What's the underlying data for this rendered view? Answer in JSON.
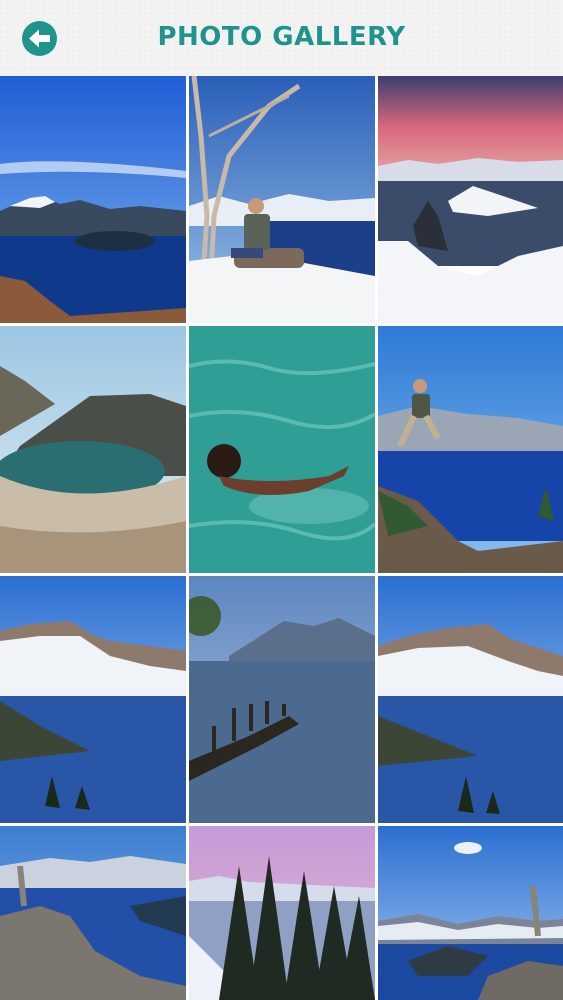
{
  "header": {
    "title": "PHOTO GALLERY",
    "back_icon": "arrow-left-icon",
    "accent_color": "#1e948c"
  },
  "gallery": {
    "photos": [
      {
        "name": "photo-lake-wizard-island"
      },
      {
        "name": "photo-man-on-rock"
      },
      {
        "name": "photo-sunset-snow-crater"
      },
      {
        "name": "photo-crater-lake-green"
      },
      {
        "name": "photo-boy-swimming"
      },
      {
        "name": "photo-man-jumping"
      },
      {
        "name": "photo-snowy-cliff-lake"
      },
      {
        "name": "photo-dock-lake"
      },
      {
        "name": "photo-snowy-cliff-lake-2"
      },
      {
        "name": "photo-rocky-viewpoint"
      },
      {
        "name": "photo-pink-sky-trees"
      },
      {
        "name": "photo-lake-blue-sky"
      }
    ]
  }
}
